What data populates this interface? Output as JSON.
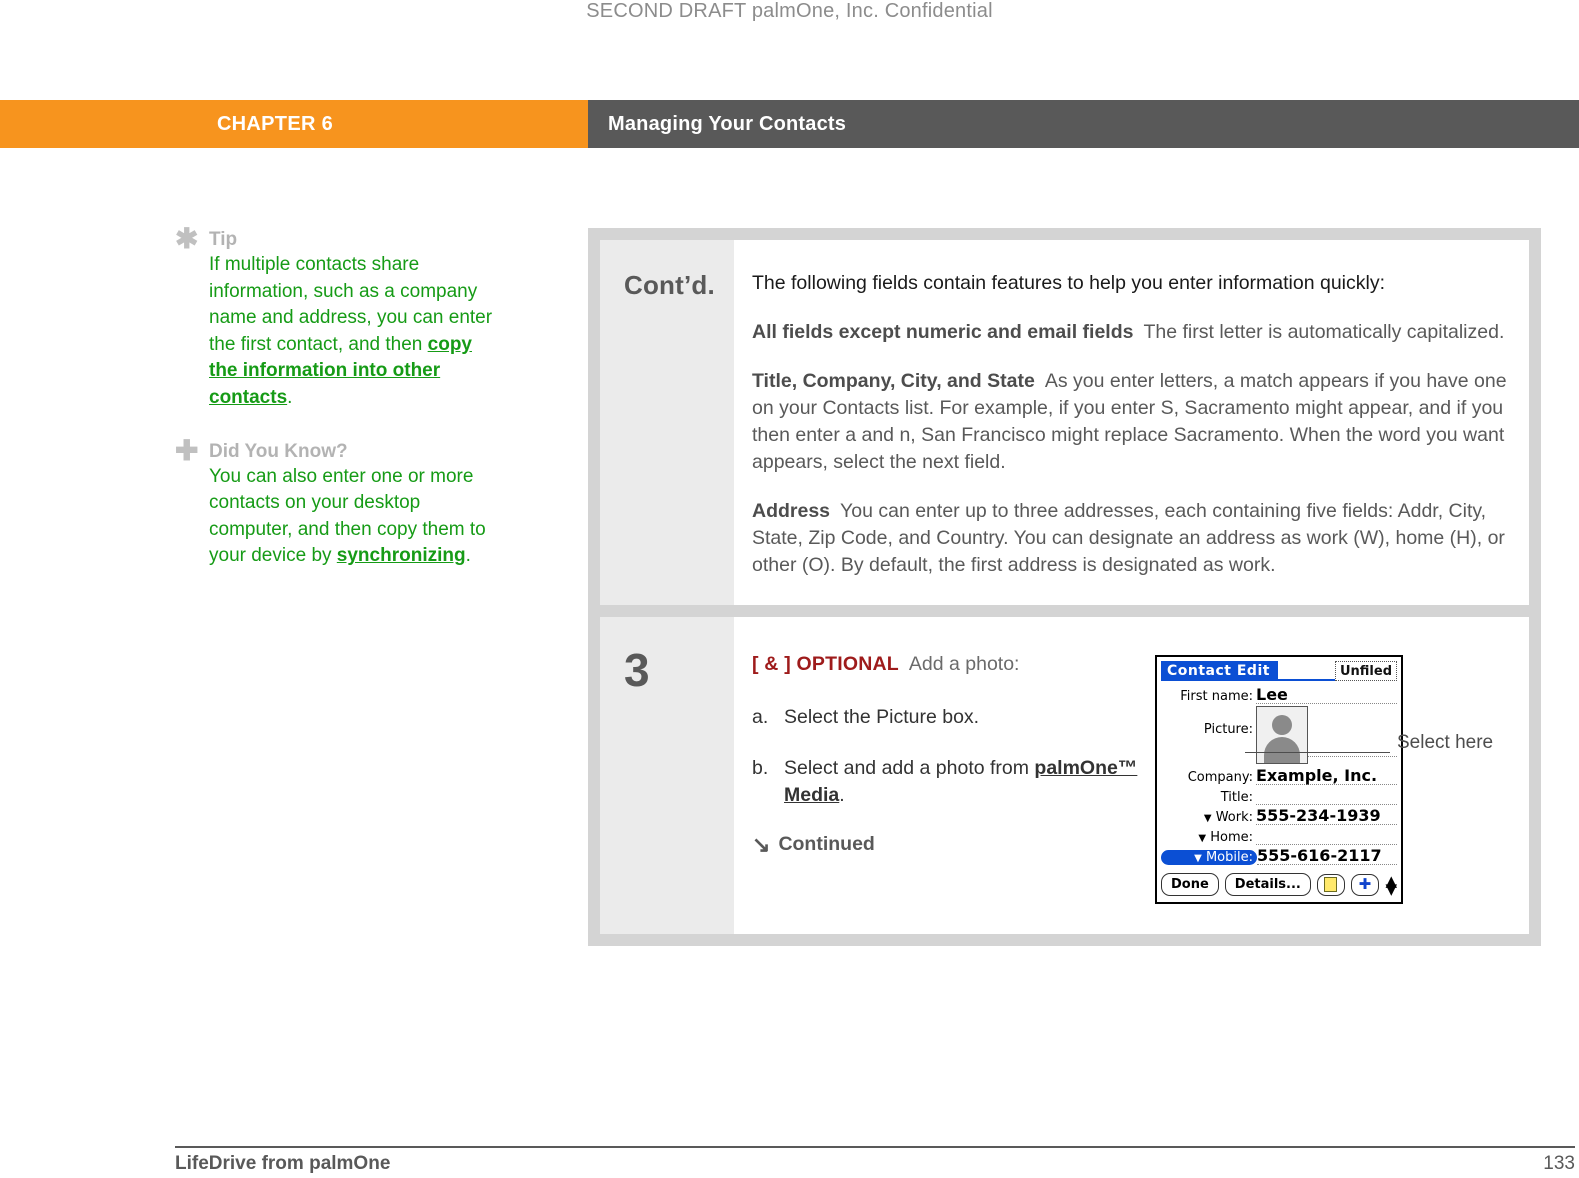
{
  "draft_notice": "SECOND DRAFT palmOne, Inc.  Confidential",
  "header": {
    "chapter_label": "CHAPTER 6",
    "chapter_title": "Managing Your Contacts",
    "orange": "#f7941e",
    "gray": "#595959"
  },
  "sidebar": {
    "tips": [
      {
        "glyph": "asterisk-icon",
        "glyph_char": "✱",
        "title": "Tip",
        "text_1": "If multiple contacts share information, such as a company name and address, you can enter the first contact, and then ",
        "link": "copy the information into other contacts",
        "text_2": "."
      },
      {
        "glyph": "plus-icon",
        "glyph_char": "✚",
        "title": "Did You Know?",
        "text_1": "You can also enter one or more contacts on your desktop computer, and then copy them to your device by ",
        "link": "synchronizing",
        "text_2": "."
      }
    ],
    "link_color": "#169b16"
  },
  "panels": {
    "contd": {
      "marker": "Cont’d.",
      "lead": "The following fields contain features to help you enter information quickly:",
      "items": [
        {
          "term": "All fields except numeric and email fields",
          "desc": "The first letter is automatically capitalized."
        },
        {
          "term": "Title, Company, City, and State",
          "desc": "As you enter letters, a match appears if you have one on your Contacts list. For example, if you enter S, Sacramento might appear, and if you then enter a and n, San Francisco might replace Sacramento. When the word you want appears, select the next field."
        },
        {
          "term": "Address",
          "desc": "You can enter up to three addresses, each containing five fields: Addr, City, State, Zip Code, and Country. You can designate an address as work (W), home (H), or other (O). By default, the first address is designated as work."
        }
      ]
    },
    "step3": {
      "marker": "3",
      "optional_tag": "[ & ]  OPTIONAL",
      "optional_rest": "Add a photo:",
      "optional_color": "#9e1b1b",
      "substeps": [
        {
          "label": "a.",
          "text_1": "Select the Picture box.",
          "link": "",
          "text_2": ""
        },
        {
          "label": "b.",
          "text_1": "Select and add a photo from ",
          "link": "palmOne™ Media",
          "text_2": "."
        }
      ],
      "continued": "Continued",
      "continued_arrow": "↘",
      "callout": "Select here"
    }
  },
  "pda": {
    "title": "Contact Edit",
    "category": "Unfiled",
    "fields": [
      {
        "label": "First name:",
        "value": "Lee",
        "caret": false,
        "selected": false
      },
      {
        "label": "Picture:",
        "value": "",
        "caret": false,
        "selected": false
      },
      {
        "label": "Company:",
        "value": "Example, Inc.",
        "caret": false,
        "selected": false
      },
      {
        "label": "Title:",
        "value": "",
        "caret": false,
        "selected": false
      },
      {
        "label": "Work:",
        "value": "555-234-1939",
        "caret": true,
        "selected": false
      },
      {
        "label": "Home:",
        "value": "",
        "caret": true,
        "selected": false
      },
      {
        "label": "Mobile:",
        "value": "555-616-2117",
        "caret": true,
        "selected": true
      }
    ],
    "buttons": [
      {
        "name": "done-button",
        "label": "Done"
      },
      {
        "name": "details-button",
        "label": "Details..."
      }
    ],
    "icon_buttons": [
      {
        "name": "note-icon",
        "label": ""
      },
      {
        "name": "plus-icon",
        "label": ""
      }
    ],
    "scroll_up": "▲",
    "scroll_down": "▼",
    "title_bg": "#0b4fd4",
    "caret_char": "▼"
  },
  "footer": {
    "left": "LifeDrive from palmOne",
    "page": "133"
  }
}
